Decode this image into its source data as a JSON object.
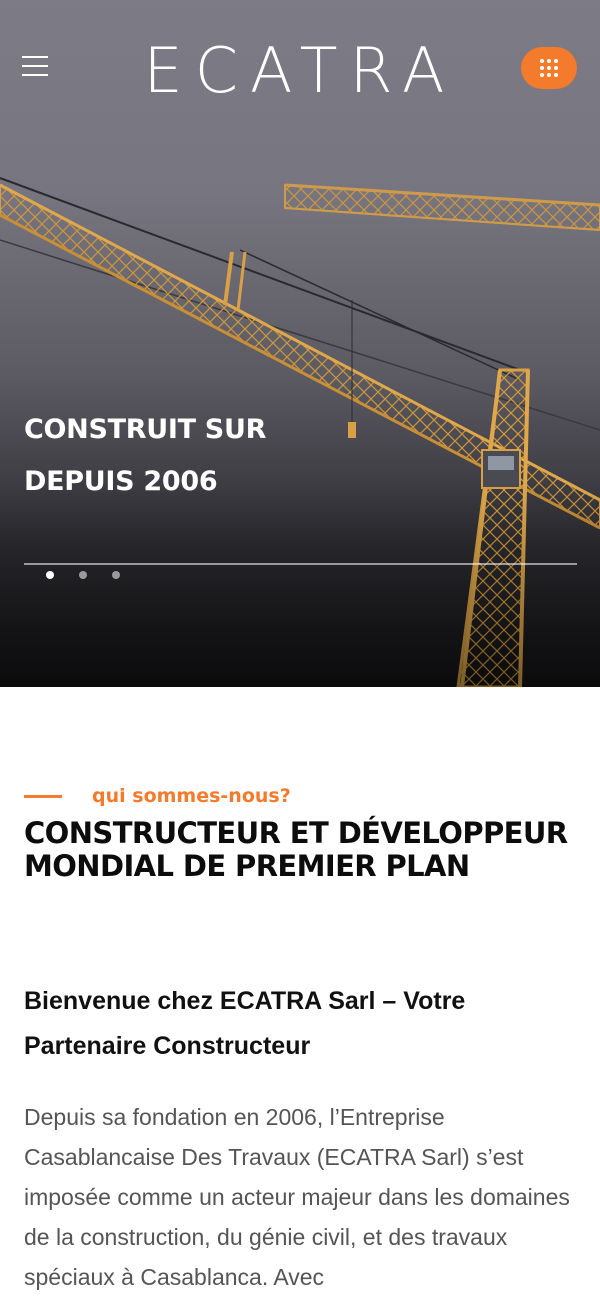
{
  "header": {
    "logo_text": "ECATRA",
    "menu_icon": "hamburger-menu-icon",
    "apps_icon": "grid-dots-icon",
    "accent_color": "#f47a2c"
  },
  "hero": {
    "title_line1": "CONSTRUIT SUR",
    "title_line2": "DEPUIS 2006",
    "slides_count": 3,
    "active_slide": 1
  },
  "about": {
    "eyebrow": "qui sommes-nous?",
    "title": "CONSTRUCTEUR ET DÉVELOPPEUR MONDIAL DE PREMIER PLAN",
    "subtitle": "Bienvenue chez ECATRA Sarl – Votre Partenaire Constructeur",
    "body": "Depuis sa fondation en 2006, l’Entreprise Casablancaise Des Travaux (ECATRA Sarl) s’est imposée comme un acteur majeur dans les domaines de la construction, du génie civil, et des travaux spéciaux à Casablanca. Avec"
  }
}
